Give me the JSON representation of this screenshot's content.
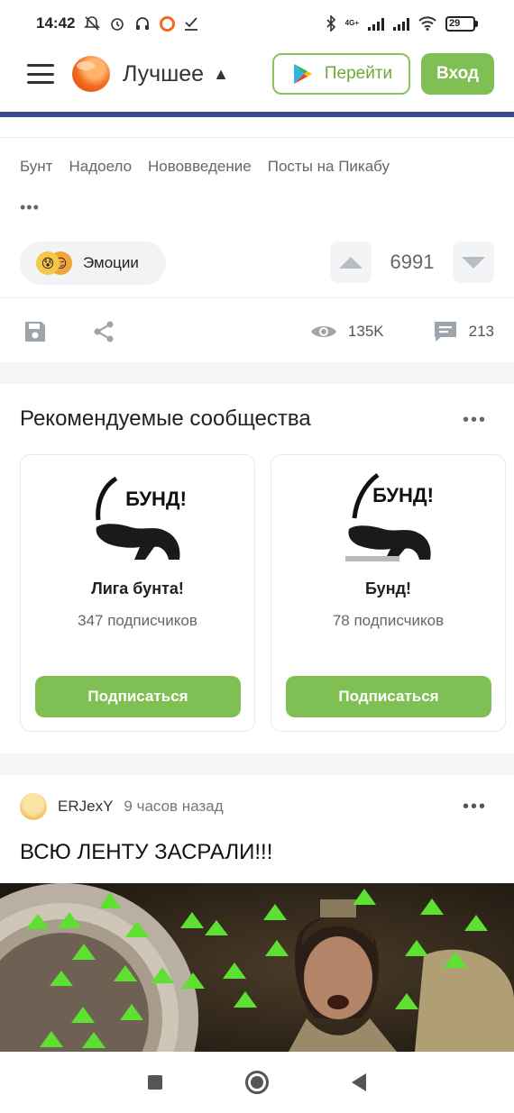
{
  "status_bar": {
    "time": "14:42",
    "network": "4G+",
    "battery": "29"
  },
  "header": {
    "title": "Лучшее",
    "go_label": "Перейти",
    "login_label": "Вход"
  },
  "post_meta": {
    "tags": [
      "Бунт",
      "Надоело",
      "Нововведение",
      "Посты на Пикабу"
    ],
    "more": "•••",
    "emotions_label": "Эмоции",
    "rating": "6991",
    "views": "135K",
    "comments": "213"
  },
  "recommended": {
    "title": "Рекомендуемые сообщества",
    "more": "•••",
    "communities": [
      {
        "image_text": "БУНД!",
        "name": "Лига бунта!",
        "subscribers": "347 подписчиков",
        "button": "Подписаться"
      },
      {
        "image_text": "БУНД!",
        "name": "Бунд!",
        "subscribers": "78 подписчиков",
        "button": "Подписаться"
      }
    ]
  },
  "post": {
    "author": "ERJexY",
    "time": "9 часов назад",
    "more": "•••",
    "title": "ВСЮ ЛЕНТУ ЗАСРАЛИ!!!"
  },
  "colors": {
    "accent_green": "#7fbf54",
    "header_line": "#3d4a8e",
    "upvote_arrow": "#5ee033"
  }
}
